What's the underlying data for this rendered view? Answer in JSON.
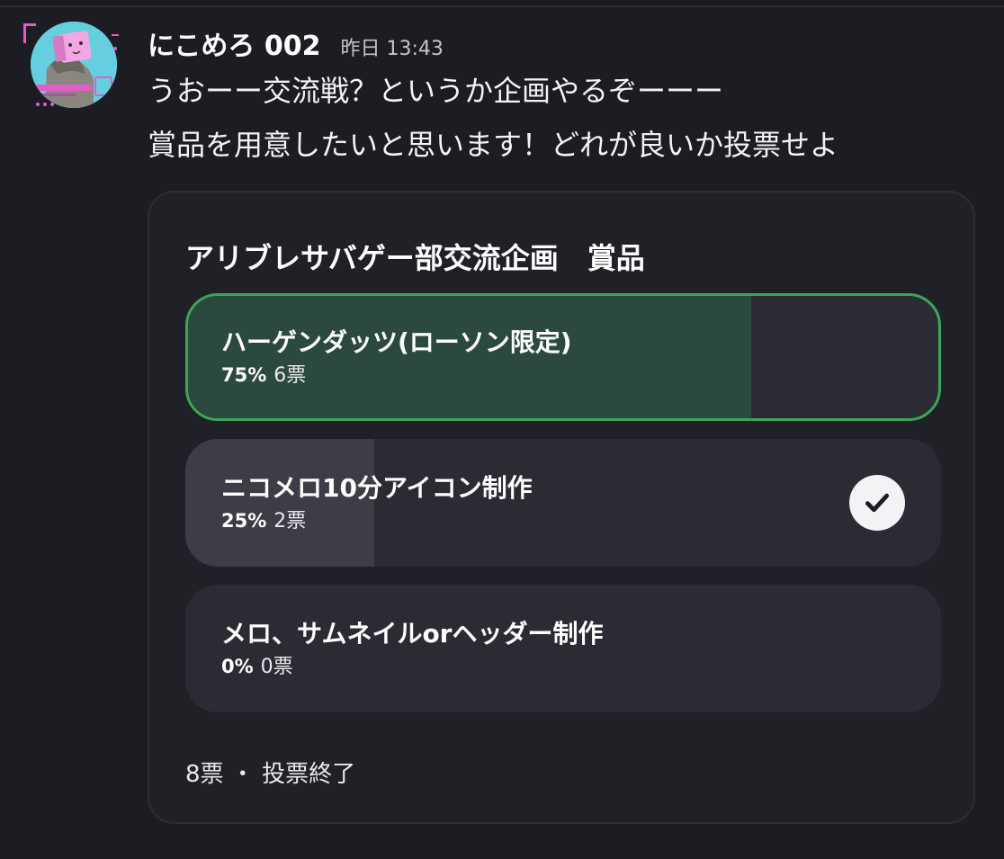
{
  "message": {
    "username": "にこめろ 002",
    "timestamp": "昨日 13:43",
    "lines": [
      "うおーー交流戦？というか企画やるぞーーー",
      "賞品を用意したいと思います！どれが良いか投票せよ"
    ]
  },
  "poll": {
    "question": "アリブレサバゲー部交流企画　賞品",
    "options": [
      {
        "label": "ハーゲンダッツ(ローソン限定)",
        "percent": "75%",
        "votes": "6票",
        "fraction": 0.75,
        "leading": true,
        "my_vote": false
      },
      {
        "label": "ニコメロ10分アイコン制作",
        "percent": "25%",
        "votes": "2票",
        "fraction": 0.25,
        "leading": false,
        "my_vote": true
      },
      {
        "label": "メロ、サムネイルorヘッダー制作",
        "percent": "0%",
        "votes": "0票",
        "fraction": 0.0,
        "leading": false,
        "my_vote": false
      }
    ],
    "footer": "8票 ・ 投票終了"
  },
  "colors": {
    "background": "#1c1d22",
    "card": "#202127",
    "leading_border": "#3ba55c",
    "leading_fill": "#2b4a3d",
    "option_fill": "#3c3d46"
  },
  "icons": {
    "avatar": "user-avatar",
    "my_vote": "checkmark-icon"
  }
}
